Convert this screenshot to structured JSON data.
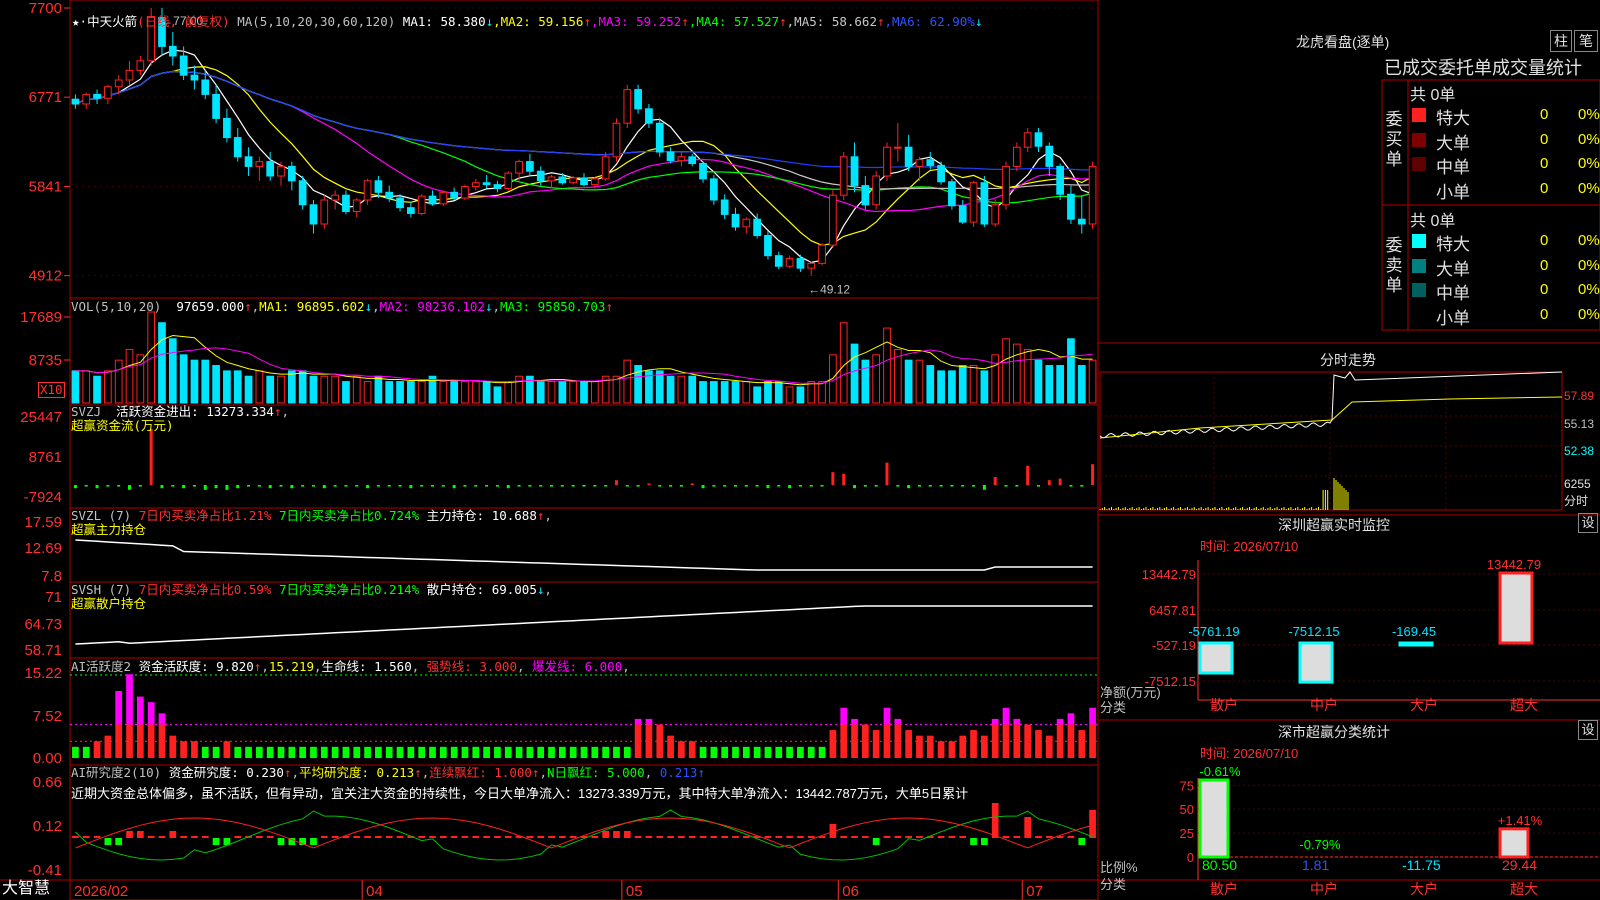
{
  "stock": {
    "name": "中天火箭",
    "period_label": "(日线, 前复权)",
    "app_name": "大智慧"
  },
  "colors": {
    "up": "#ff2020",
    "down": "#00e5ff",
    "grid": "#b00000",
    "ma1": "#ffffff",
    "ma2": "#ffff00",
    "ma3": "#ff00ff",
    "ma4": "#00ff00",
    "ma5": "#c8c8c8",
    "ma6": "#2040ff"
  },
  "chart_data": [
    {
      "type": "candlestick",
      "panel": "price",
      "dates_axis": [
        "2026/02",
        "04",
        "05",
        "06",
        "07"
      ],
      "y_ticks": [
        7700,
        6771,
        5841,
        4912
      ],
      "ylim": [
        4700,
        7700
      ],
      "annotations": [
        {
          "text": "77.00",
          "kind": "max"
        },
        {
          "text": "49.12",
          "kind": "min"
        }
      ],
      "ohlc": [
        [
          6750,
          6800,
          6650,
          6700
        ],
        [
          6700,
          6820,
          6650,
          6800
        ],
        [
          6800,
          6850,
          6700,
          6760
        ],
        [
          6760,
          6900,
          6700,
          6880
        ],
        [
          6880,
          7000,
          6800,
          6950
        ],
        [
          6950,
          7150,
          6900,
          7050
        ],
        [
          7050,
          7200,
          7000,
          7150
        ],
        [
          7150,
          7700,
          7100,
          7600
        ],
        [
          7600,
          7700,
          7200,
          7300
        ],
        [
          7300,
          7450,
          7100,
          7200
        ],
        [
          7200,
          7300,
          6950,
          7000
        ],
        [
          7000,
          7100,
          6850,
          6950
        ],
        [
          6950,
          7050,
          6750,
          6800
        ],
        [
          6800,
          6900,
          6500,
          6550
        ],
        [
          6550,
          6650,
          6300,
          6350
        ],
        [
          6350,
          6450,
          6100,
          6150
        ],
        [
          6150,
          6250,
          5950,
          6050
        ],
        [
          6050,
          6150,
          5900,
          6100
        ],
        [
          6100,
          6200,
          5900,
          5950
        ],
        [
          5950,
          6100,
          5850,
          6050
        ],
        [
          6050,
          6100,
          5800,
          5900
        ],
        [
          5900,
          5950,
          5600,
          5650
        ],
        [
          5650,
          5700,
          5350,
          5450
        ],
        [
          5450,
          5750,
          5400,
          5700
        ],
        [
          5700,
          5800,
          5600,
          5750
        ],
        [
          5750,
          5800,
          5550,
          5580
        ],
        [
          5580,
          5720,
          5520,
          5700
        ],
        [
          5700,
          5920,
          5650,
          5900
        ],
        [
          5900,
          5950,
          5720,
          5780
        ],
        [
          5780,
          5850,
          5680,
          5720
        ],
        [
          5720,
          5760,
          5580,
          5620
        ],
        [
          5620,
          5680,
          5520,
          5560
        ],
        [
          5560,
          5760,
          5540,
          5740
        ],
        [
          5740,
          5800,
          5640,
          5660
        ],
        [
          5660,
          5800,
          5640,
          5780
        ],
        [
          5780,
          5830,
          5700,
          5720
        ],
        [
          5720,
          5860,
          5700,
          5840
        ],
        [
          5840,
          5920,
          5800,
          5880
        ],
        [
          5880,
          5960,
          5820,
          5860
        ],
        [
          5860,
          5900,
          5780,
          5820
        ],
        [
          5820,
          6000,
          5800,
          5980
        ],
        [
          5980,
          6120,
          5900,
          6100
        ],
        [
          6100,
          6180,
          5950,
          6000
        ],
        [
          6000,
          6050,
          5850,
          5900
        ],
        [
          5900,
          5960,
          5820,
          5940
        ],
        [
          5940,
          5980,
          5860,
          5880
        ],
        [
          5880,
          5950,
          5860,
          5930
        ],
        [
          5930,
          5980,
          5840,
          5860
        ],
        [
          5860,
          5940,
          5820,
          5920
        ],
        [
          5920,
          6200,
          5900,
          6150
        ],
        [
          6150,
          6550,
          6100,
          6500
        ],
        [
          6500,
          6900,
          6450,
          6850
        ],
        [
          6850,
          6900,
          6600,
          6650
        ],
        [
          6650,
          6700,
          6450,
          6500
        ],
        [
          6500,
          6550,
          6150,
          6200
        ],
        [
          6200,
          6250,
          6080,
          6110
        ],
        [
          6110,
          6200,
          6050,
          6150
        ],
        [
          6150,
          6180,
          6050,
          6080
        ],
        [
          6080,
          6100,
          5880,
          5920
        ],
        [
          5920,
          5960,
          5650,
          5700
        ],
        [
          5700,
          5760,
          5500,
          5550
        ],
        [
          5550,
          5620,
          5380,
          5420
        ],
        [
          5420,
          5520,
          5350,
          5500
        ],
        [
          5500,
          5560,
          5300,
          5330
        ],
        [
          5330,
          5380,
          5080,
          5120
        ],
        [
          5120,
          5160,
          4980,
          5010
        ],
        [
          5010,
          5120,
          4990,
          5090
        ],
        [
          5090,
          5130,
          4950,
          4990
        ],
        [
          4990,
          5060,
          4912,
          5040
        ],
        [
          5040,
          5250,
          5020,
          5230
        ],
        [
          5230,
          5800,
          5200,
          5750
        ],
        [
          5750,
          6200,
          5700,
          6150
        ],
        [
          6150,
          6300,
          5780,
          5850
        ],
        [
          5850,
          5950,
          5600,
          5650
        ],
        [
          5650,
          6000,
          5600,
          5950
        ],
        [
          5950,
          6300,
          5900,
          6250
        ],
        [
          6250,
          6500,
          6100,
          6250
        ],
        [
          6250,
          6380,
          6000,
          6050
        ],
        [
          6050,
          6150,
          5900,
          6120
        ],
        [
          6120,
          6200,
          6020,
          6060
        ],
        [
          6060,
          6100,
          5860,
          5890
        ],
        [
          5890,
          5920,
          5600,
          5640
        ],
        [
          5640,
          5700,
          5450,
          5470
        ],
        [
          5470,
          5900,
          5420,
          5880
        ],
        [
          5880,
          5950,
          5420,
          5450
        ],
        [
          5450,
          5700,
          5420,
          5650
        ],
        [
          5650,
          6100,
          5600,
          6050
        ],
        [
          6050,
          6300,
          6000,
          6250
        ],
        [
          6250,
          6450,
          6200,
          6400
        ],
        [
          6400,
          6450,
          6200,
          6260
        ],
        [
          6260,
          6300,
          5950,
          6050
        ],
        [
          6050,
          6080,
          5700,
          5760
        ],
        [
          5760,
          5850,
          5450,
          5500
        ],
        [
          5500,
          5750,
          5350,
          5450
        ],
        [
          5450,
          6100,
          5400,
          6050
        ]
      ],
      "ma": [
        {
          "name": "MA1",
          "value": "58.380",
          "arrow": "↓"
        },
        {
          "name": "MA2",
          "value": "59.156",
          "arrow": "↑"
        },
        {
          "name": "MA3",
          "value": "59.252",
          "arrow": "↑"
        },
        {
          "name": "MA4",
          "value": "57.527",
          "arrow": "↑"
        },
        {
          "name": "MA5",
          "value": "58.662",
          "arrow": "↑"
        },
        {
          "name": "MA6",
          "value": "62.90%",
          "arrow": "↓"
        }
      ]
    },
    {
      "type": "bar",
      "panel": "volume",
      "y_ticks": [
        17689,
        8735
      ],
      "unit_label": "X10",
      "values": [
        6,
        6,
        5,
        6,
        8,
        10,
        9,
        17,
        15,
        12,
        9,
        8,
        8,
        7,
        6,
        6,
        5,
        6,
        5,
        5,
        6,
        6,
        5,
        5,
        5,
        4,
        5,
        4,
        5,
        4,
        4,
        4,
        4,
        5,
        4,
        4,
        4,
        4,
        4,
        3,
        4,
        5,
        5,
        4,
        4,
        4,
        4,
        4,
        4,
        5,
        5,
        8,
        7,
        6,
        6,
        5,
        5,
        5,
        4,
        4,
        4,
        4,
        4,
        3,
        4,
        4,
        3,
        3,
        4,
        4,
        9,
        15,
        11,
        8,
        9,
        14,
        10,
        8,
        8,
        7,
        6,
        6,
        7,
        7,
        6,
        9,
        12,
        11,
        10,
        8,
        7,
        7,
        12,
        7,
        8
      ]
    },
    {
      "type": "bar",
      "panel": "svzj",
      "y_ticks": [
        25447,
        8761,
        -7924
      ],
      "values": [
        -2,
        -1,
        -2,
        -1,
        -1,
        -3,
        -1,
        35,
        -2,
        -1,
        -2,
        -1,
        -3,
        -2,
        -3,
        -2,
        -1,
        -1,
        -2,
        -1,
        -2,
        -1,
        -1,
        -2,
        -1,
        -1,
        -1,
        -2,
        -1,
        -1,
        -1,
        -2,
        -1,
        -1,
        -1,
        -2,
        -1,
        -1,
        -1,
        -1,
        -2,
        -1,
        -1,
        -1,
        -1,
        -1,
        -1,
        -1,
        -1,
        -1,
        3,
        -1,
        -1,
        1,
        -1,
        -1,
        -1,
        1,
        -2,
        -1,
        -1,
        -1,
        -1,
        -1,
        -2,
        -1,
        -2,
        -1,
        -1,
        -1,
        8,
        7,
        -2,
        -1,
        -1,
        14,
        -1,
        -2,
        -1,
        -1,
        -1,
        -1,
        -1,
        -1,
        -3,
        5,
        -1,
        -1,
        12,
        -1,
        3,
        4,
        -1,
        -1,
        13
      ]
    },
    {
      "type": "line",
      "panel": "svzl",
      "y_ticks": [
        17.59,
        12.69,
        7.8
      ]
    },
    {
      "type": "line",
      "panel": "svsh",
      "y_ticks": [
        71.0,
        64.73,
        58.71
      ]
    },
    {
      "type": "bar",
      "panel": "ai_active",
      "y_ticks": [
        15.22,
        7.52,
        0.0
      ],
      "values": [
        2,
        2,
        3,
        4,
        12,
        15,
        11,
        10,
        8,
        4,
        3,
        3,
        2,
        2,
        3,
        2,
        2,
        2,
        2,
        2,
        2,
        2,
        2,
        2,
        2,
        2,
        2,
        2,
        2,
        2,
        2,
        2,
        2,
        2,
        2,
        2,
        2,
        2,
        2,
        2,
        2,
        2,
        2,
        2,
        2,
        2,
        2,
        2,
        2,
        2,
        2,
        2,
        7,
        7,
        6,
        4,
        3,
        3,
        2,
        2,
        2,
        2,
        2,
        2,
        2,
        2,
        2,
        2,
        2,
        2,
        5,
        9,
        7,
        6,
        5,
        9,
        7,
        5,
        4,
        4,
        3,
        3,
        4,
        5,
        4,
        7,
        9,
        7,
        6,
        5,
        4,
        7,
        8,
        5,
        9
      ]
    },
    {
      "type": "bar",
      "panel": "ai_research",
      "y_ticks": [
        0.66,
        0.12,
        -0.41
      ],
      "values": [
        0,
        0,
        0,
        -1,
        -1,
        1,
        1,
        0,
        0,
        1,
        0,
        0,
        0,
        -1,
        -1,
        0,
        0,
        0,
        0,
        -1,
        -1,
        -1,
        -1,
        0,
        0,
        0,
        0,
        0,
        0,
        0,
        0,
        0,
        0,
        0,
        0,
        0,
        0,
        0,
        0,
        0,
        0,
        0,
        0,
        0,
        0,
        0,
        0,
        0,
        0,
        1,
        1,
        1,
        0,
        0,
        0,
        0,
        0,
        0,
        0,
        0,
        0,
        0,
        0,
        0,
        0,
        0,
        0,
        0,
        0,
        0,
        2,
        0,
        0,
        0,
        -1,
        0,
        0,
        0,
        0,
        0,
        0,
        0,
        0,
        -1,
        -1,
        5,
        0,
        0,
        3,
        0,
        0,
        0,
        0,
        -1,
        4
      ]
    }
  ],
  "indicators": {
    "vol": {
      "label": "VOL(5,10,20)",
      "v": "97659.000",
      "v_arrow": "↑",
      "ma1": "MA1: 96895.602",
      "ma1_arrow": "↓",
      "ma2": "MA2: 98236.102",
      "ma2_arrow": "↓",
      "ma3": "MA3: 95850.703",
      "ma3_arrow": "↑"
    },
    "svzj": {
      "label": "SVZJ",
      "name": "活跃资金进出: 13273.334",
      "arrow": "↑",
      "subtitle": "超赢资金流(万元)"
    },
    "svzl": {
      "label": "SVZL (7)",
      "p1": "7日内买卖净占比1.21%",
      "p2": "7日内买卖净占比0.724%",
      "p3": "主力持仓: 10.688",
      "arrow": "↑",
      "subtitle": "超赢主力持仓"
    },
    "svsh": {
      "label": "SVSH (7)",
      "p1": "7日内买卖净占比0.59%",
      "p2": "7日内买卖净占比0.214%",
      "p3": "散户持仓: 69.005",
      "arrow": "↓",
      "subtitle": "超赢散户持仓"
    },
    "ai1": {
      "label": "AI活跃度2",
      "p1": "资金活跃度: 9.820",
      "p1a": "↑",
      "p2": "15.219",
      "p3": "生命线: 1.560",
      "p4": "强势线: 3.000",
      "p5": "爆发线: 6.000"
    },
    "ai2": {
      "label": "AI研究度2(10)",
      "p1": "资金研究度: 0.230",
      "p1a": "↑",
      "p2": "平均研究度: 0.213",
      "p2a": "↑",
      "p3": "连续飘红: 1.000",
      "p3a": "↑",
      "p4": "N日飘红: 5.000",
      "p5": "0.213",
      "p5a": "↑"
    },
    "note": "近期大资金总体偏多，虽不活跃，但有异动，宜关注大资金的持续性，今日大单净流入：13273.339万元，其中特大单净流入：13442.787万元，大单5日累计"
  },
  "right": {
    "lhb_title": "龙虎看盘(逐单)",
    "btn1": "柱",
    "btn2": "笔",
    "tabs_line": "已成交委托单成交量统计",
    "buy_label": "委买单",
    "sell_label": "委卖单",
    "buy_total": "共 0单",
    "sell_total": "共 0单",
    "rows_buy": [
      {
        "name": "特大",
        "v": "0",
        "p": "0%",
        "c": "#ff2020"
      },
      {
        "name": "大单",
        "v": "0",
        "p": "0%",
        "c": "#800000"
      },
      {
        "name": "中单",
        "v": "0",
        "p": "0%",
        "c": "#600000"
      },
      {
        "name": "小单",
        "v": "0",
        "p": "0%",
        "c": "#000000"
      }
    ],
    "rows_sell": [
      {
        "name": "特大",
        "v": "0",
        "p": "0%",
        "c": "#00ffff"
      },
      {
        "name": "大单",
        "v": "0",
        "p": "0%",
        "c": "#008080"
      },
      {
        "name": "中单",
        "v": "0",
        "p": "0%",
        "c": "#006060"
      },
      {
        "name": "小单",
        "v": "0",
        "p": "0%",
        "c": "#000000"
      }
    ],
    "fenshi_title": "分时走势",
    "fenshi_ticks": [
      "57.89",
      "55.13",
      "52.38",
      "6255"
    ],
    "fenshi_unit": "分时",
    "monitor_title": "深圳超赢实时监控",
    "settings": "设",
    "time_label": "时间: 2026/07/10",
    "mon_ticks": [
      "13442.79",
      "6457.81",
      "-527.19",
      "-7512.15"
    ],
    "mon_values": [
      {
        "cat": "散户",
        "val": "-5761.19",
        "n": -5761.19
      },
      {
        "cat": "中户",
        "val": "-7512.15",
        "n": -7512.15
      },
      {
        "cat": "大户",
        "val": "-169.45",
        "n": -169.45
      },
      {
        "cat": "超大",
        "val": "13442.79",
        "n": 13442.79
      }
    ],
    "mon_ylabel": "净额(万元)",
    "mon_xlabel": "分类",
    "cls_title": "深市超赢分类统计",
    "cls_time": "时间: 2026/07/10",
    "cls_ticks": [
      "75",
      "50",
      "25",
      "0"
    ],
    "cls_values": [
      {
        "cat": "散户",
        "top": "-0.61%",
        "bottom": "80.50",
        "n": 80.5
      },
      {
        "cat": "中户",
        "top": "-0.79%",
        "bottom": "1.81",
        "n": 1.81
      },
      {
        "cat": "大户",
        "top": "",
        "bottom": "-11.75",
        "n": 0
      },
      {
        "cat": "超大",
        "top": "+1.41%",
        "bottom": "29.44",
        "n": 29.44
      }
    ],
    "cls_ylabel": "比例%",
    "cls_xlabel": "分类"
  }
}
